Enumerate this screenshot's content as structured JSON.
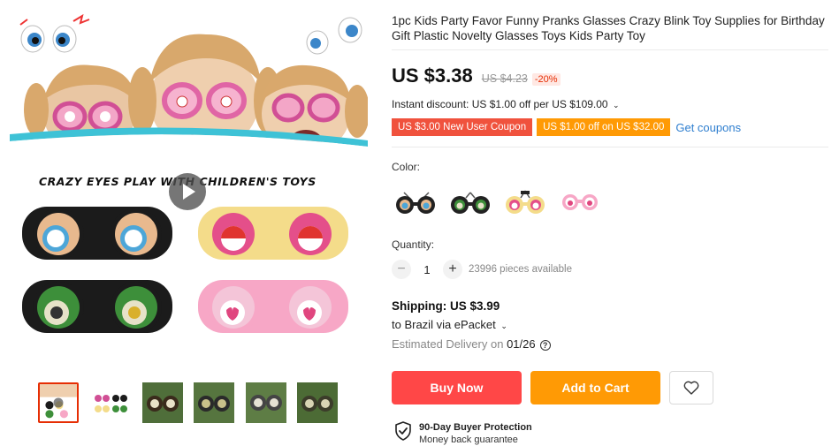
{
  "gallery": {
    "banner_title": "CRAZY EYES PLAY WITH CHILDREN'S TOYS",
    "thumbnails": [
      "main-collage",
      "four-colors",
      "brown-pair",
      "green-pair",
      "grey-pair",
      "olive-pair"
    ],
    "active_thumbnail": 0
  },
  "product": {
    "title": "1pc Kids Party Favor Funny Pranks Glasses Crazy Blink Toy Supplies for Birthday Gift Plastic Novelty Glasses Toys Kids Party Toy",
    "price": "US $3.38",
    "old_price": "US $4.23",
    "discount": "-20%",
    "instant_discount": "Instant discount: US $1.00 off per US $109.00",
    "coupons": [
      {
        "label": "US $3.00 New User Coupon",
        "color": "#f0523d"
      },
      {
        "label": "US $1.00 off on US $32.00",
        "color": "#ff9a05"
      }
    ],
    "get_coupons": "Get coupons"
  },
  "options": {
    "color_label": "Color:",
    "colors": [
      "black",
      "green",
      "yellow",
      "pink"
    ],
    "quantity_label": "Quantity:",
    "quantity": "1",
    "available": "23996 pieces available"
  },
  "shipping": {
    "title": "Shipping: US $3.99",
    "via": "to Brazil via ePacket",
    "estimated_prefix": "Estimated Delivery on ",
    "estimated_date": "01/26"
  },
  "actions": {
    "buy_now": "Buy Now",
    "add_to_cart": "Add to Cart"
  },
  "protection": {
    "title": "90-Day Buyer Protection",
    "subtitle": "Money back guarantee"
  },
  "colors": {
    "accent_red": "#ff4747",
    "accent_orange": "#ff9a05",
    "link_blue": "#2e7ecf"
  }
}
